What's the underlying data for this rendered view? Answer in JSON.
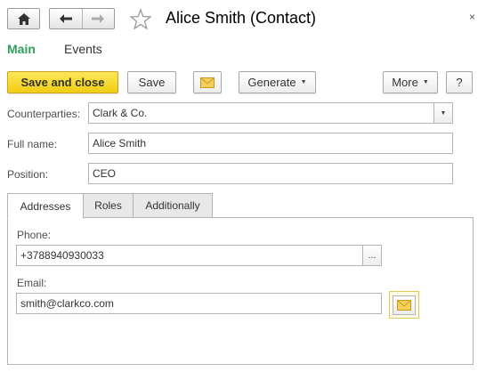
{
  "window": {
    "title": "Alice Smith (Contact)",
    "close_glyph": "×",
    "home_icon": "home-icon",
    "back_icon": "back-arrow-icon",
    "forward_icon": "forward-arrow-icon",
    "favorite_icon": "star-icon"
  },
  "sections": {
    "main": "Main",
    "events": "Events"
  },
  "toolbar": {
    "save_and_close": "Save and close",
    "save": "Save",
    "email_icon": "envelope-icon",
    "generate": "Generate",
    "more": "More",
    "help": "?"
  },
  "form": {
    "counterparties_label": "Counterparties:",
    "counterparties_value": "Clark & Co.",
    "full_name_label": "Full name:",
    "full_name_value": "Alice Smith",
    "position_label": "Position:",
    "position_value": "CEO"
  },
  "tabs": {
    "addresses": "Addresses",
    "roles": "Roles",
    "additionally": "Additionally"
  },
  "addresses": {
    "phone_label": "Phone:",
    "phone_value": "+3788940930033",
    "phone_select": "...",
    "email_label": "Email:",
    "email_value": "smith@clarkco.com"
  },
  "colors": {
    "accent_green": "#2e9d5f",
    "primary_yellow": "#f1cc13"
  }
}
